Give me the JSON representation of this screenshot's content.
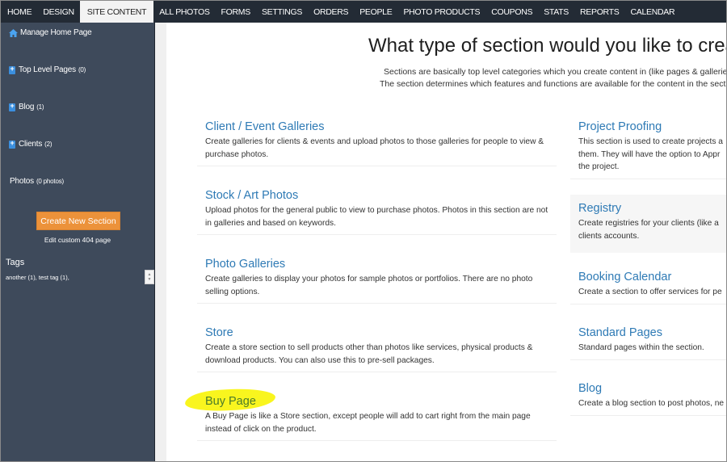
{
  "nav": {
    "items": [
      {
        "label": "HOME",
        "active": false
      },
      {
        "label": "DESIGN",
        "active": false
      },
      {
        "label": "SITE CONTENT",
        "active": true
      },
      {
        "label": "ALL PHOTOS",
        "active": false
      },
      {
        "label": "FORMS",
        "active": false
      },
      {
        "label": "SETTINGS",
        "active": false
      },
      {
        "label": "ORDERS",
        "active": false
      },
      {
        "label": "PEOPLE",
        "active": false
      },
      {
        "label": "PHOTO PRODUCTS",
        "active": false
      },
      {
        "label": "COUPONS",
        "active": false
      },
      {
        "label": "STATS",
        "active": false
      },
      {
        "label": "REPORTS",
        "active": false
      },
      {
        "label": "CALENDAR",
        "active": false
      }
    ]
  },
  "sidebar": {
    "manage_home": {
      "label": "Manage Home Page",
      "icon": "home-icon"
    },
    "items": [
      {
        "label": "Top Level Pages",
        "count": "(0)",
        "icon": "add-page-icon"
      },
      {
        "label": "Blog",
        "count": "(1)",
        "icon": "add-page-icon"
      },
      {
        "label": "Clients",
        "count": "(2)",
        "icon": "add-page-icon"
      }
    ],
    "photos": {
      "label": "Photos",
      "count": "(0 photos)"
    },
    "create_button": "Create New Section",
    "edit_404": "Edit custom 404 page",
    "tags_title": "Tags",
    "tags_list": "another (1), test tag (1),"
  },
  "main": {
    "title": "What type of section would you like to create?",
    "intro_line1": "Sections are basically top level categories which you create content in (like pages & galleries).",
    "intro_line2": "The section determines which features and functions are available for the content in the section.",
    "left_sections": [
      {
        "title": "Client / Event Galleries",
        "desc": "Create galleries for clients & events and upload photos to those galleries for people to view & purchase photos."
      },
      {
        "title": "Stock / Art Photos",
        "desc": "Upload photos for the general public to view to purchase photos. Photos in this section are not in galleries and based on keywords."
      },
      {
        "title": "Photo Galleries",
        "desc": "Create galleries to display your photos for sample photos or portfolios. There are no photo selling options."
      },
      {
        "title": "Store",
        "desc": "Create a store section to sell products other than photos like services, physical products & download products. You can also use this to pre-sell packages."
      },
      {
        "title": "Buy Page",
        "desc": "A Buy Page is like a Store section, except people will add to cart right from the main page instead of click on the product.",
        "highlighted": true
      }
    ],
    "right_sections": [
      {
        "title": "Project Proofing",
        "desc_lines": [
          "This section is used to create projects a",
          "them. They will have the option to Appr",
          "the project."
        ]
      },
      {
        "title": "Registry",
        "desc_lines": [
          "Create registries for your clients (like a",
          "clients accounts."
        ],
        "hovered": true
      },
      {
        "title": "Booking Calendar",
        "desc_lines": [
          "Create a section to offer services for pe"
        ]
      },
      {
        "title": "Standard Pages",
        "desc_lines": [
          "Standard pages within the section."
        ]
      },
      {
        "title": "Blog",
        "desc_lines": [
          "Create a blog section to post photos, ne"
        ]
      }
    ]
  },
  "colors": {
    "nav_bg": "#232b35",
    "sidebar_bg": "#3e4a5b",
    "accent_button": "#ec923a",
    "section_title": "#2e7ab5",
    "highlight": "#f9f51e"
  }
}
